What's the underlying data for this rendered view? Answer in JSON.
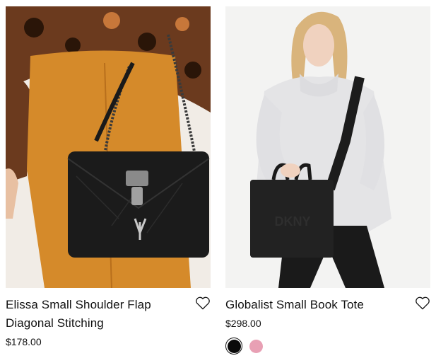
{
  "products": [
    {
      "name": "Elissa Small Shoulder Flap Diagonal Stitching",
      "price": "$178.00",
      "image_alt": "Black quilted shoulder flap bag with chain strap"
    },
    {
      "name": "Globalist Small Book Tote",
      "price": "$298.00",
      "image_alt": "Black book tote carried by model in white sweater",
      "swatches": [
        {
          "color": "#0a0a0a",
          "selected": true
        },
        {
          "color": "#e8a0b4",
          "selected": false
        }
      ]
    }
  ],
  "colors": {
    "text": "#111111",
    "background": "#ffffff"
  },
  "icons": {
    "wishlist": "heart-outline-icon"
  }
}
